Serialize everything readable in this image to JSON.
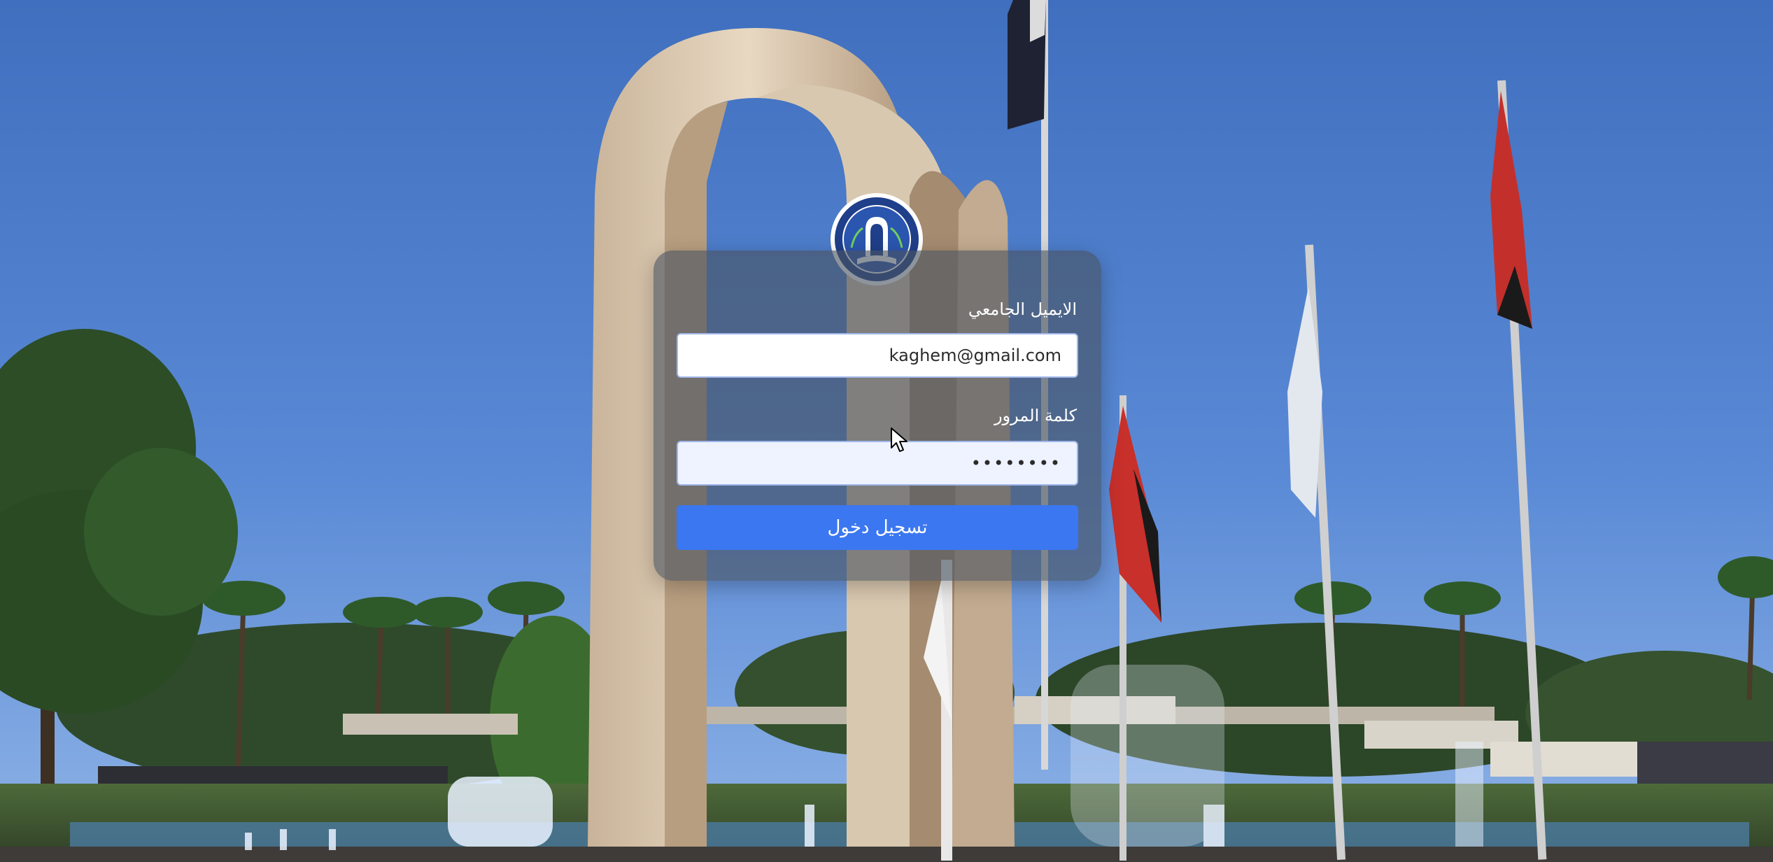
{
  "login": {
    "email_label": "الايميل الجامعي",
    "email_value": "kaghem@gmail.com",
    "password_label": "كلمة المرور",
    "password_value": "••••••••",
    "submit_label": "تسجيل دخول"
  },
  "icons": {
    "logo": "university-seal-logo",
    "cursor": "mouse-pointer-icon"
  },
  "colors": {
    "primary_button": "#3b77f0",
    "card_overlay": "#485260",
    "sky": "#4a7ac9"
  }
}
